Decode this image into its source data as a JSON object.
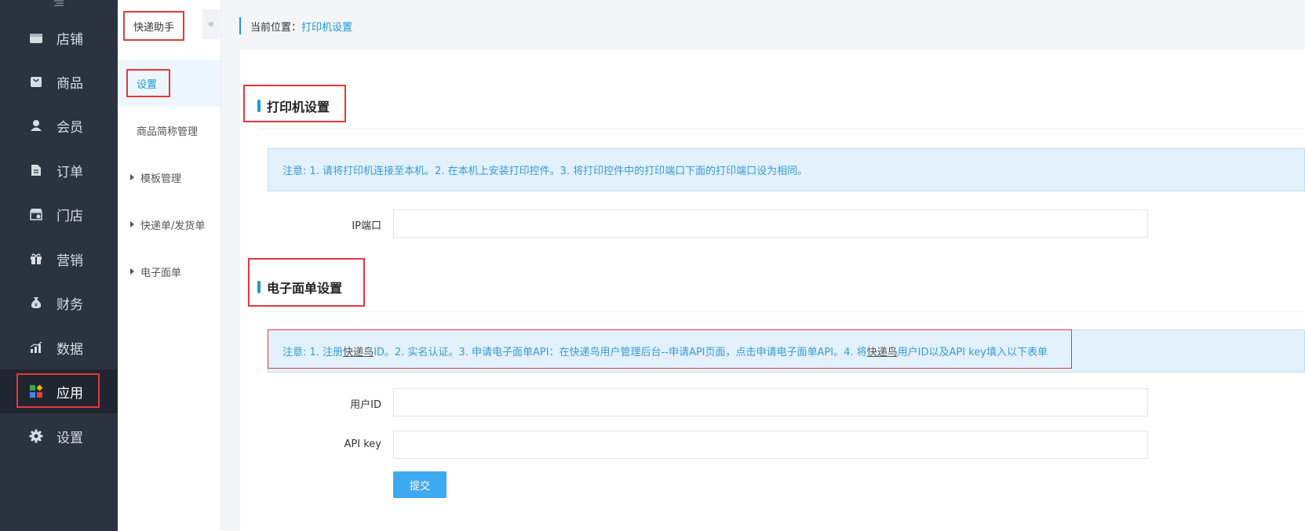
{
  "sidebar": {
    "items": [
      {
        "label": "店铺",
        "icon": "store-icon"
      },
      {
        "label": "商品",
        "icon": "bag-icon"
      },
      {
        "label": "会员",
        "icon": "user-icon"
      },
      {
        "label": "订单",
        "icon": "document-icon"
      },
      {
        "label": "门店",
        "icon": "shop-icon"
      },
      {
        "label": "营销",
        "icon": "gift-icon"
      },
      {
        "label": "财务",
        "icon": "money-bag-icon"
      },
      {
        "label": "数据",
        "icon": "bar-chart-icon"
      },
      {
        "label": "应用",
        "icon": "apps-icon",
        "active": true
      },
      {
        "label": "设置",
        "icon": "gear-icon"
      }
    ]
  },
  "subnav": {
    "title": "快递助手",
    "items": [
      {
        "label": "设置",
        "active": true
      },
      {
        "label": "商品简称管理"
      },
      {
        "label": "模板管理",
        "expandable": true
      },
      {
        "label": "快递单/发货单",
        "expandable": true
      },
      {
        "label": "电子面单",
        "expandable": true
      }
    ]
  },
  "breadcrumb": {
    "prefix": "当前位置：",
    "current": "打印机设置"
  },
  "printer_section": {
    "title": "打印机设置",
    "notice": "注意: 1. 请将打印机连接至本机。2. 在本机上安装打印控件。3. 将打印控件中的打印端口下面的打印端口设为相同。",
    "ip_label": "IP端口",
    "ip_value": ""
  },
  "ebill_section": {
    "title": "电子面单设置",
    "notice_parts": [
      "注意: 1. 注册",
      "快递鸟",
      "ID。2. 实名认证。3. 申请电子面单API：在快递鸟用户管理后台--申请API页面，点击申请电子面单API。4. 将",
      "快递鸟",
      "用户ID以及API key填入以下表单"
    ],
    "user_id_label": "用户ID",
    "user_id_value": "",
    "api_key_label": "API key",
    "api_key_value": "",
    "submit_label": "提交"
  },
  "colors": {
    "sidebar_bg": "#2b3340",
    "accent": "#1a9ae0",
    "highlight": "#e5383b",
    "notice_bg": "#e2f1fb",
    "submit_bg": "#3fa9f0"
  }
}
